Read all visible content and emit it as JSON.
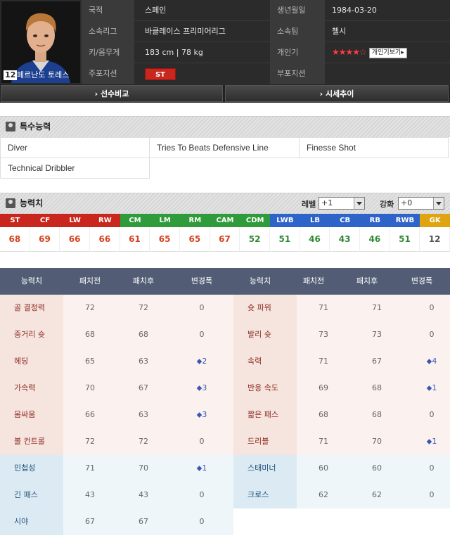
{
  "player": {
    "number": "12",
    "name": "페르난도 토레스",
    "info": [
      {
        "label": "국적",
        "value": "스페인",
        "label2": "생년월일",
        "value2": "1984-03-20"
      },
      {
        "label": "소속리그",
        "value": "바클레이스 프리미어리그",
        "label2": "소속팀",
        "value2": "첼시"
      },
      {
        "label": "키/몸무게",
        "value": "183 cm  |  78 kg",
        "label2": "개인기",
        "value2": "★★★★☆"
      },
      {
        "label": "주포지션",
        "value": "ST",
        "label2": "부포지션",
        "value2": ""
      }
    ],
    "personal_skill_button": "개인기보기▸",
    "nav": {
      "compare": "› 선수비교",
      "trend": "› 시세추이"
    }
  },
  "special": {
    "title": "특수능력",
    "traits": [
      "Diver",
      "Tries To Beats Defensive Line",
      "Finesse Shot",
      "Technical Dribbler"
    ]
  },
  "abilities": {
    "title": "능력치",
    "level_label": "레벨",
    "level_value": "+1",
    "enhance_label": "강화",
    "enhance_value": "+0",
    "positions": [
      {
        "pos": "ST",
        "value": "68",
        "color": "#c9261d",
        "text_color": "#d6441e"
      },
      {
        "pos": "CF",
        "value": "69",
        "color": "#c9261d",
        "text_color": "#d6441e"
      },
      {
        "pos": "LW",
        "value": "66",
        "color": "#c9261d",
        "text_color": "#d6441e"
      },
      {
        "pos": "RW",
        "value": "66",
        "color": "#c9261d",
        "text_color": "#d6441e"
      },
      {
        "pos": "CM",
        "value": "61",
        "color": "#2f9b3a",
        "text_color": "#d6441e"
      },
      {
        "pos": "LM",
        "value": "65",
        "color": "#2f9b3a",
        "text_color": "#d6441e"
      },
      {
        "pos": "RM",
        "value": "65",
        "color": "#2f9b3a",
        "text_color": "#d6441e"
      },
      {
        "pos": "CAM",
        "value": "67",
        "color": "#2f9b3a",
        "text_color": "#d6441e"
      },
      {
        "pos": "CDM",
        "value": "52",
        "color": "#2f9b3a",
        "text_color": "#2f8a35"
      },
      {
        "pos": "LWB",
        "value": "51",
        "color": "#2e63c9",
        "text_color": "#2f8a35"
      },
      {
        "pos": "LB",
        "value": "46",
        "color": "#2e63c9",
        "text_color": "#2f8a35"
      },
      {
        "pos": "CB",
        "value": "43",
        "color": "#2e63c9",
        "text_color": "#2f8a35"
      },
      {
        "pos": "RB",
        "value": "46",
        "color": "#2e63c9",
        "text_color": "#2f8a35"
      },
      {
        "pos": "RWB",
        "value": "51",
        "color": "#2e63c9",
        "text_color": "#2f8a35"
      },
      {
        "pos": "GK",
        "value": "12",
        "color": "#e0a312",
        "text_color": "#555555"
      }
    ]
  },
  "stat_table": {
    "headers": [
      "능력치",
      "패치전",
      "패치후",
      "변경폭",
      "능력치",
      "패치전",
      "패치후",
      "변경폭"
    ],
    "left": [
      {
        "name": "골 결정력",
        "before": "72",
        "after": "72",
        "change": "0",
        "group": "attack"
      },
      {
        "name": "중거리 슛",
        "before": "68",
        "after": "68",
        "change": "0",
        "group": "attack"
      },
      {
        "name": "헤딩",
        "before": "65",
        "after": "63",
        "change": "⬥2",
        "group": "attack"
      },
      {
        "name": "가속력",
        "before": "70",
        "after": "67",
        "change": "⬥3",
        "group": "attack"
      },
      {
        "name": "몸싸움",
        "before": "66",
        "after": "63",
        "change": "⬥3",
        "group": "attack"
      },
      {
        "name": "볼 컨트롤",
        "before": "72",
        "after": "72",
        "change": "0",
        "group": "attack"
      },
      {
        "name": "민첩성",
        "before": "71",
        "after": "70",
        "change": "⬥1",
        "group": "other"
      },
      {
        "name": "긴 패스",
        "before": "43",
        "after": "43",
        "change": "0",
        "group": "other"
      },
      {
        "name": "시야",
        "before": "67",
        "after": "67",
        "change": "0",
        "group": "other"
      }
    ],
    "right": [
      {
        "name": "슛 파워",
        "before": "71",
        "after": "71",
        "change": "0",
        "group": "attack"
      },
      {
        "name": "발리 슛",
        "before": "73",
        "after": "73",
        "change": "0",
        "group": "attack"
      },
      {
        "name": "속력",
        "before": "71",
        "after": "67",
        "change": "⬥4",
        "group": "attack"
      },
      {
        "name": "반응 속도",
        "before": "69",
        "after": "68",
        "change": "⬥1",
        "group": "attack"
      },
      {
        "name": "짧은 패스",
        "before": "68",
        "after": "68",
        "change": "0",
        "group": "attack"
      },
      {
        "name": "드리블",
        "before": "71",
        "after": "70",
        "change": "⬥1",
        "group": "attack"
      },
      {
        "name": "스태미너",
        "before": "60",
        "after": "60",
        "change": "0",
        "group": "other"
      },
      {
        "name": "크로스",
        "before": "62",
        "after": "62",
        "change": "0",
        "group": "other"
      }
    ],
    "colors": {
      "attack_name_bg": "#f6e4de",
      "attack_row_bg": "#fbf1ee",
      "other_name_bg": "#dcebf3",
      "other_row_bg": "#eef6fa",
      "attack_name_color": "#8b2b1f",
      "other_name_color": "#1f4f7a"
    }
  }
}
